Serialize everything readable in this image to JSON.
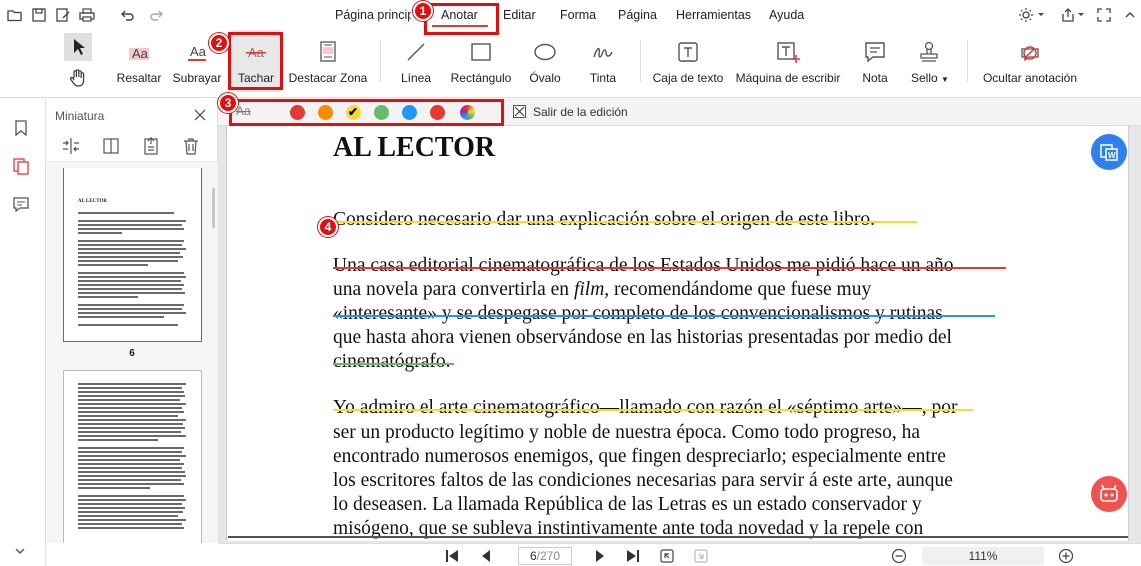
{
  "menubar": {
    "items": [
      "Página principal",
      "Anotar",
      "Editar",
      "Forma",
      "Página",
      "Herramientas",
      "Ayuda"
    ]
  },
  "ribbon": {
    "tools": [
      "Resaltar",
      "Subrayar",
      "Tachar",
      "Destacar Zona",
      "Línea",
      "Rectángulo",
      "Óvalo",
      "Tinta",
      "Caja de texto",
      "Máquina de escribir",
      "Nota",
      "Sello",
      "Ocultar anotación"
    ]
  },
  "thumbnails": {
    "title": "Miniatura",
    "selected_page_number": "6",
    "selected_page_heading": "AL LECTOR"
  },
  "stylebar": {
    "aa_label": "Aa",
    "colors": [
      "#e53935",
      "#fb8c00",
      "#fdd835",
      "#66bb6a",
      "#2196f3",
      "#e53935",
      "#9c27b0"
    ],
    "selected_color_index": 2,
    "exit_label": "Salir de la edición"
  },
  "document": {
    "heading": "AL LECTOR",
    "lines": [
      "Considero necesario dar una explicación sobre el origen de este libro.",
      "Una casa editorial cinematográfica de los Estados Unidos me pidió hace un año",
      "una novela para convertirla en film, recomendándome que fuese muy",
      "«interesante» y se despegase por completo de los convencionalismos y rutinas",
      "que hasta ahora vienen observándose en las historias presentadas por medio del",
      "cinematógrafo.",
      "Yo admiro el arte cinematográfico—llamado con razón el «séptimo arte»—, por",
      "ser un producto legítimo y noble de nuestra época. Como todo progreso, ha",
      "encontrado numerosos enemigos, que fingen despreciarlo; especialmente entre",
      "los escritores faltos de las condiciones necesarias para servir á este arte, aunque",
      "lo deseasen. La llamada República de las Letras es un estado conservador y",
      "misógeno, que se subleva instintivamente ante toda novedad y la repele con"
    ],
    "strike_colors": {
      "line1": "#fdd835",
      "line2": "#e53935",
      "line4": "#2196f3",
      "line6": "#66bb6a",
      "line7": "#fdd835"
    }
  },
  "statusbar": {
    "current_page": "6",
    "total_pages": "/270",
    "zoom": "111%"
  },
  "callouts": [
    "1",
    "2",
    "3",
    "4"
  ]
}
